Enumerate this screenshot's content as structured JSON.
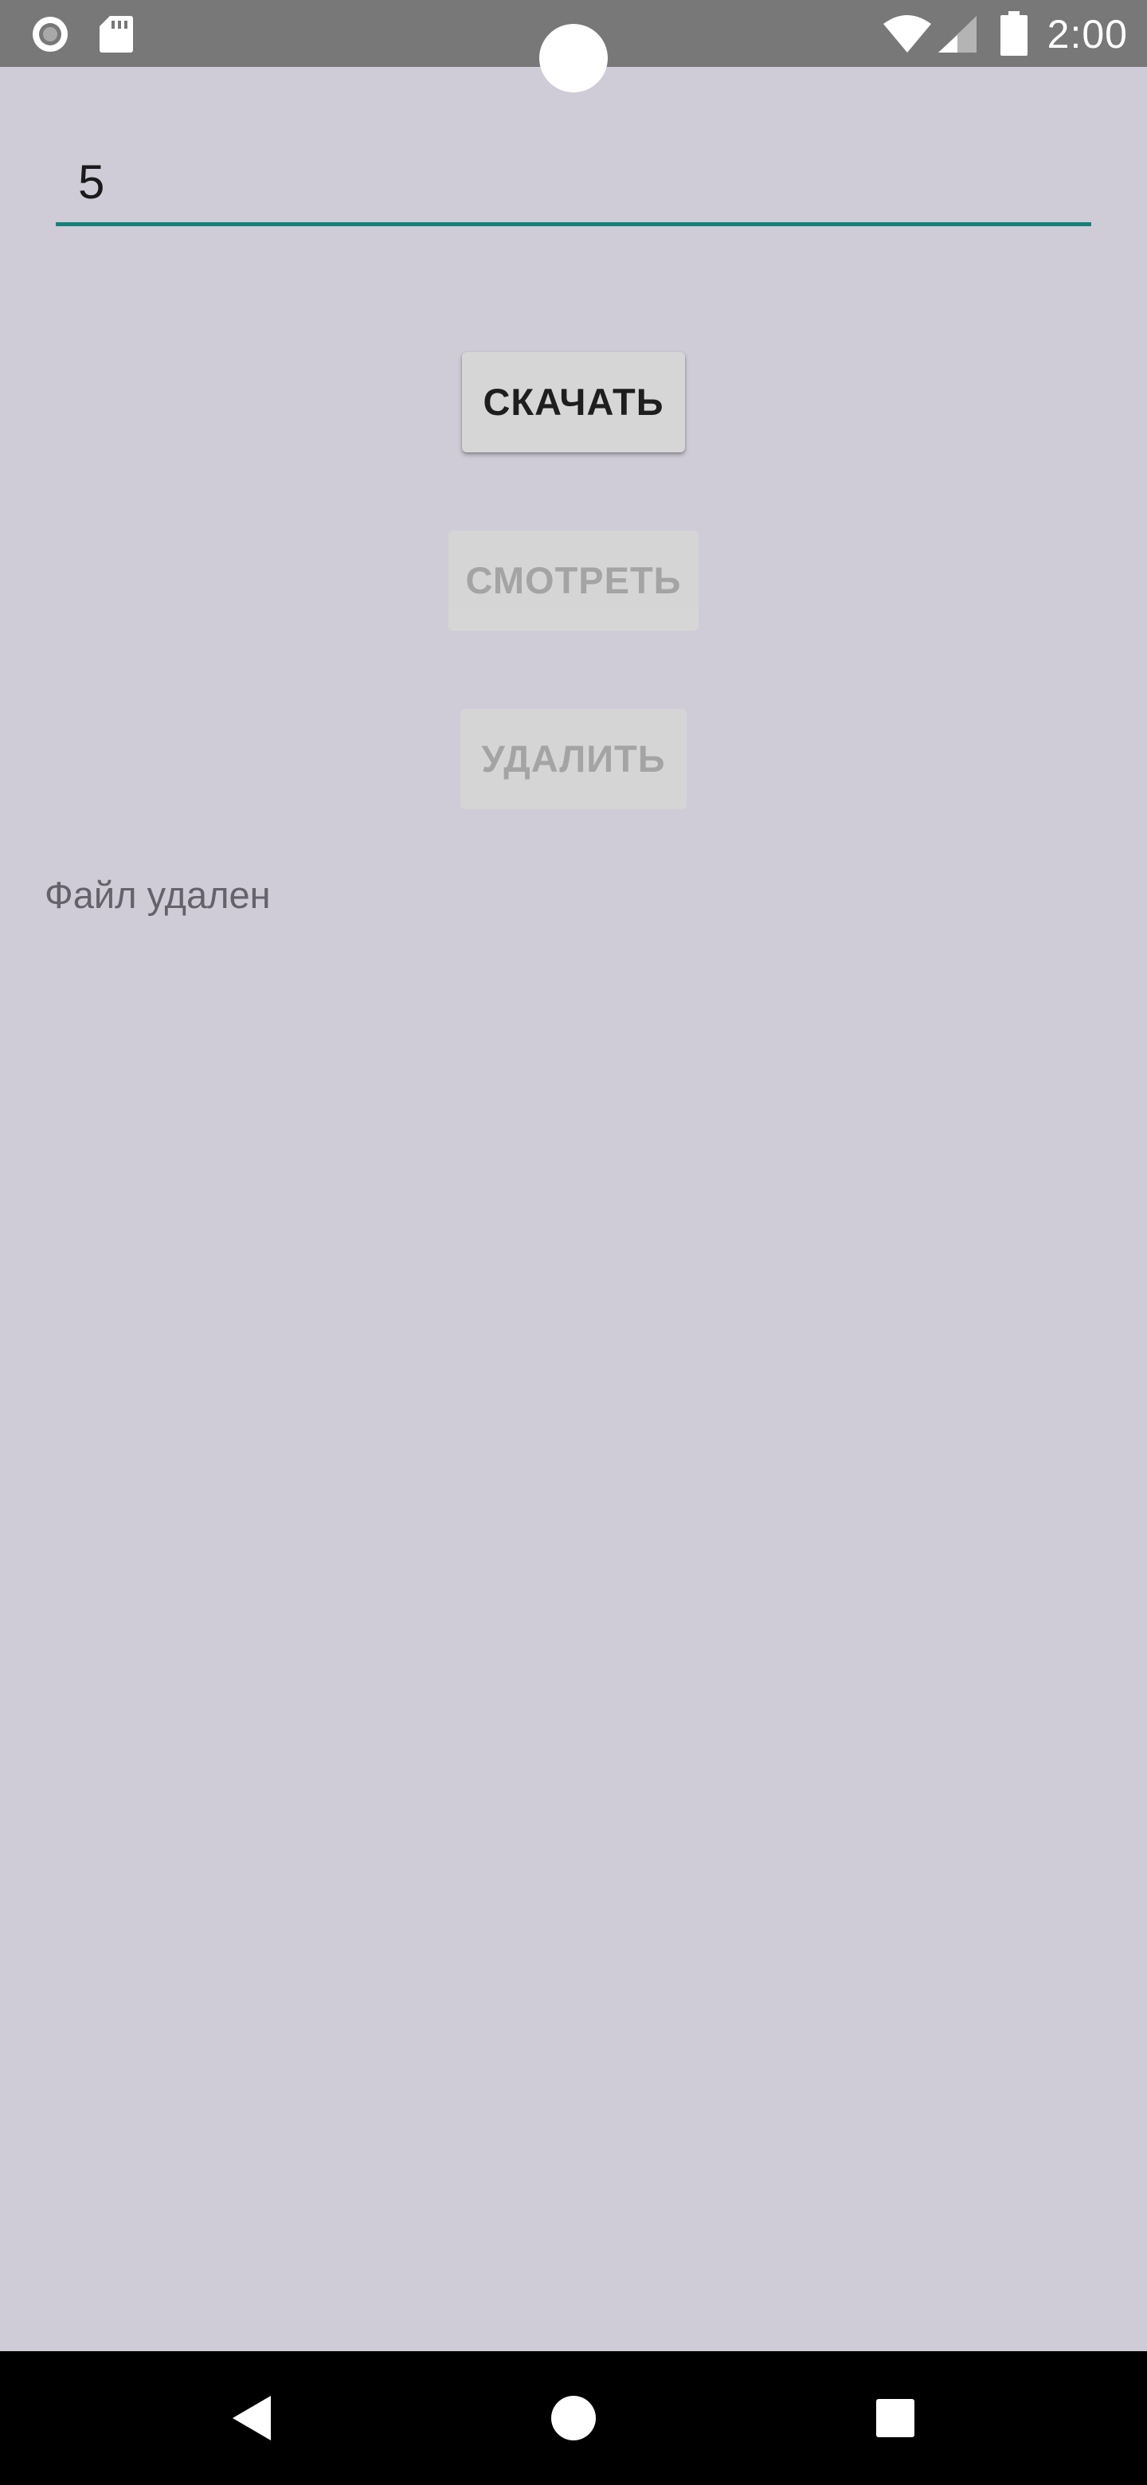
{
  "status_bar": {
    "time": "2:00",
    "left_icons": [
      "record-icon",
      "sd-card-icon"
    ],
    "right_icons": [
      "wifi-icon",
      "cell-signal-icon",
      "battery-icon"
    ]
  },
  "input": {
    "value": "5",
    "accent_color": "#168079"
  },
  "buttons": {
    "download_label": "СКАЧАТЬ",
    "view_label": "СМОТРЕТЬ",
    "delete_label": "УДАЛИТЬ"
  },
  "status_message": "Файл удален",
  "nav_bar": {
    "icons": [
      "back-icon",
      "home-icon",
      "recents-icon"
    ]
  },
  "colors": {
    "background": "#cfccd8",
    "status_bar": "#787878",
    "button": "#d6d6d6",
    "disabled_text": "#a2a2a2"
  }
}
